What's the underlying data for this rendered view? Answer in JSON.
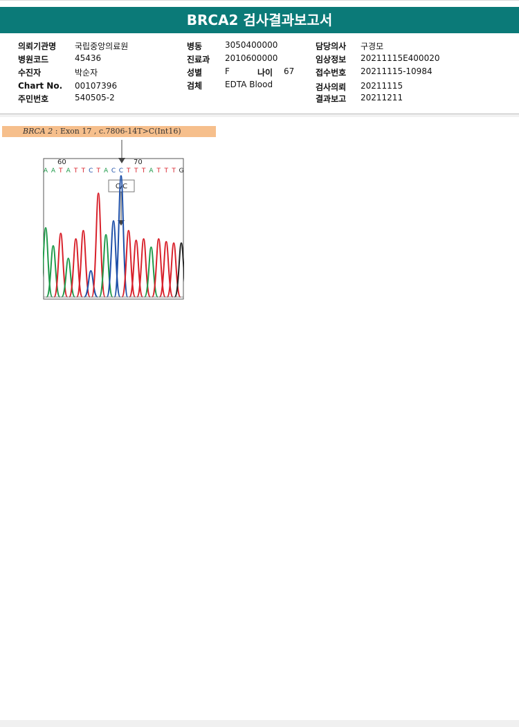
{
  "report": {
    "title": "BRCA2 검사결과보고서"
  },
  "info": {
    "requesting_institution": {
      "label": "의뢰기관명",
      "value": "국립중앙의료원"
    },
    "hospital_code": {
      "label": "병원코드",
      "value": "45436"
    },
    "recipient": {
      "label": "수진자",
      "value": "박순자"
    },
    "chart_no": {
      "label": "Chart No.",
      "value": "00107396"
    },
    "resident_no": {
      "label": "주민번호",
      "value": "540505-2"
    },
    "ward": {
      "label": "병동",
      "value": "3050400000"
    },
    "department": {
      "label": "진료과",
      "value": "2010600000"
    },
    "sex": {
      "label": "성별",
      "value": "F"
    },
    "age": {
      "label": "나이",
      "value": "67"
    },
    "specimen": {
      "label": "검체",
      "value": "EDTA Blood"
    },
    "physician": {
      "label": "담당의사",
      "value": "구경모"
    },
    "clinical_info": {
      "label": "임상정보",
      "value": "20211115E400020"
    },
    "accession_no": {
      "label": "접수번호",
      "value": "20211115-10984"
    },
    "request_date": {
      "label": "검사의뢰",
      "value": "20211115"
    },
    "report_date": {
      "label": "결과보고",
      "value": "20211211"
    }
  },
  "variant": {
    "gene": "BRCA 2",
    "sep": " : ",
    "description": "Exon 17 , c.7806-14T>C(Int16)"
  },
  "chromatogram": {
    "position_labels": [
      "60",
      "70"
    ],
    "sequence": [
      "A",
      "A",
      "T",
      "A",
      "T",
      "T",
      "C",
      "T",
      "A",
      "C",
      "C",
      "T",
      "T",
      "T",
      "A",
      "T",
      "T",
      "T",
      "G"
    ],
    "genotype_label": "C/C",
    "base_colors": {
      "A": "#1f9a4a",
      "T": "#d8202a",
      "C": "#1d4fa8",
      "G": "#222222"
    }
  }
}
